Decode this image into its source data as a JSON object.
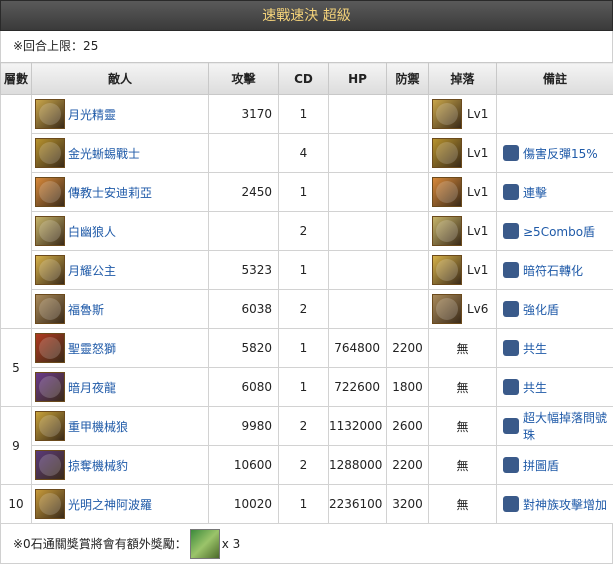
{
  "title": "速戰速決 超級",
  "limit_text": "※回合上限：25",
  "headers": [
    "層數",
    "敵人",
    "攻擊",
    "CD",
    "HP",
    "防禦",
    "掉落",
    "備註"
  ],
  "rows": [
    {
      "enemy": "月光精靈",
      "atk": "3170",
      "cd": "1",
      "hp": "",
      "def": "",
      "drop": "Lv1",
      "note": "",
      "note_icon": "",
      "icon_color": "#c9a64a"
    },
    {
      "enemy": "金光蜥蜴戰士",
      "atk": "",
      "cd": "4",
      "hp": "",
      "def": "",
      "drop": "Lv1",
      "note": "傷害反彈15%",
      "note_icon": "reflect-icon",
      "icon_color": "#b8932e"
    },
    {
      "enemy": "傳教士安迪莉亞",
      "atk": "2450",
      "cd": "1",
      "hp": "",
      "def": "",
      "drop": "Lv1",
      "note": "連擊",
      "note_icon": "combo-hit-icon",
      "icon_color": "#d8893a"
    },
    {
      "enemy": "白幽狼人",
      "atk": "",
      "cd": "2",
      "hp": "",
      "def": "",
      "drop": "Lv1",
      "note": "≥5Combo盾",
      "note_icon": "combo-shield-icon",
      "icon_color": "#c6b46a"
    },
    {
      "enemy": "月耀公主",
      "atk": "5323",
      "cd": "1",
      "hp": "",
      "def": "",
      "drop": "Lv1",
      "note": "暗符石轉化",
      "note_icon": "rune-convert-icon",
      "icon_color": "#d7b24a"
    },
    {
      "enemy": "福魯斯",
      "atk": "6038",
      "cd": "2",
      "hp": "",
      "def": "",
      "drop": "Lv6",
      "note": "強化盾",
      "note_icon": "shield-icon",
      "icon_color": "#a98a5a"
    },
    {
      "enemy": "聖靈怒獅",
      "atk": "5820",
      "cd": "1",
      "hp": "764800",
      "def": "2200",
      "drop": "無",
      "note": "共生",
      "note_icon": "cross-icon",
      "icon_color": "#b03a20"
    },
    {
      "enemy": "暗月夜龍",
      "atk": "6080",
      "cd": "1",
      "hp": "722600",
      "def": "1800",
      "drop": "無",
      "note": "共生",
      "note_icon": "cross-icon",
      "icon_color": "#6a3a8a"
    },
    {
      "enemy": "重甲機械狼",
      "atk": "9980",
      "cd": "2",
      "hp": "1132000",
      "def": "2600",
      "drop": "無",
      "note": "超大幅掉落問號珠",
      "note_icon": "question-icon",
      "icon_color": "#c8a23a"
    },
    {
      "enemy": "掠奪機械豹",
      "atk": "10600",
      "cd": "2",
      "hp": "1288000",
      "def": "2200",
      "drop": "無",
      "note": "拼圖盾",
      "note_icon": "puzzle-icon",
      "icon_color": "#5a3a7a"
    },
    {
      "enemy": "光明之神阿波羅",
      "atk": "10020",
      "cd": "1",
      "hp": "2236100",
      "def": "3200",
      "drop": "無",
      "note": "對神族攻擊增加",
      "note_icon": "god-race-icon",
      "icon_color": "#c79a3a"
    }
  ],
  "floors": {
    "f1": "",
    "f2": "5",
    "f3": "9",
    "f4": "10"
  },
  "footer": {
    "text": "※0石通關獎賞將會有額外獎勵：",
    "count": "x 3"
  }
}
